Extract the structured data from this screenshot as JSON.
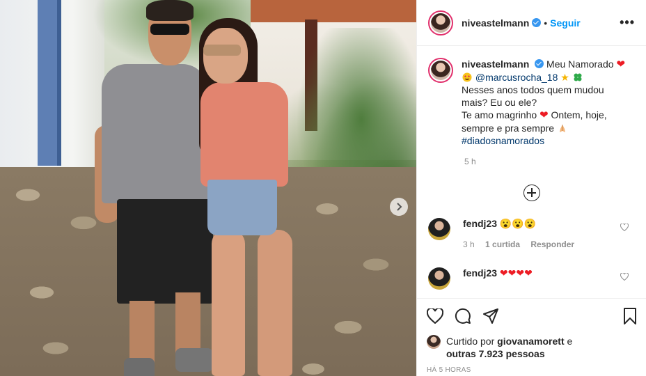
{
  "post": {
    "username": "niveastelmann",
    "follow_label": "Seguir",
    "more_label": "•••",
    "caption": {
      "author": "niveastelmann",
      "line1_text": "Meu Namorado",
      "mention": "@marcusrocha_18",
      "line3": "Nesses anos todos quem mudou",
      "line4": "mais? Eu ou ele?",
      "line5_text": "Te amo magrinho",
      "line5_after": "Ontem, hoje,",
      "line6_text": "sempre e pra sempre",
      "hashtag": "#diadosnamorados"
    },
    "caption_time": "5 h",
    "comments": [
      {
        "user": "fendj23",
        "text": "😮😮😮",
        "time": "3 h",
        "likes": "1 curtida",
        "reply": "Responder"
      },
      {
        "user": "fendj23",
        "text": "❤❤❤❤"
      }
    ],
    "likes": {
      "prefix": "Curtido por",
      "liker": "giovanamorett",
      "conj": "e",
      "others": "outras 7.923 pessoas"
    },
    "date": "HÁ 5 HORAS"
  },
  "icons": {
    "verified": "verified-badge-icon",
    "like": "heart-icon",
    "comment": "comment-icon",
    "share": "paper-plane-icon",
    "save": "bookmark-icon",
    "next": "chevron-right-icon",
    "load_more": "plus-circle-icon"
  },
  "colors": {
    "link": "#00376b",
    "follow": "#0095f6",
    "verified": "#3897f0",
    "heart_emoji": "#ed1c24",
    "muted": "#8e8e8e"
  }
}
